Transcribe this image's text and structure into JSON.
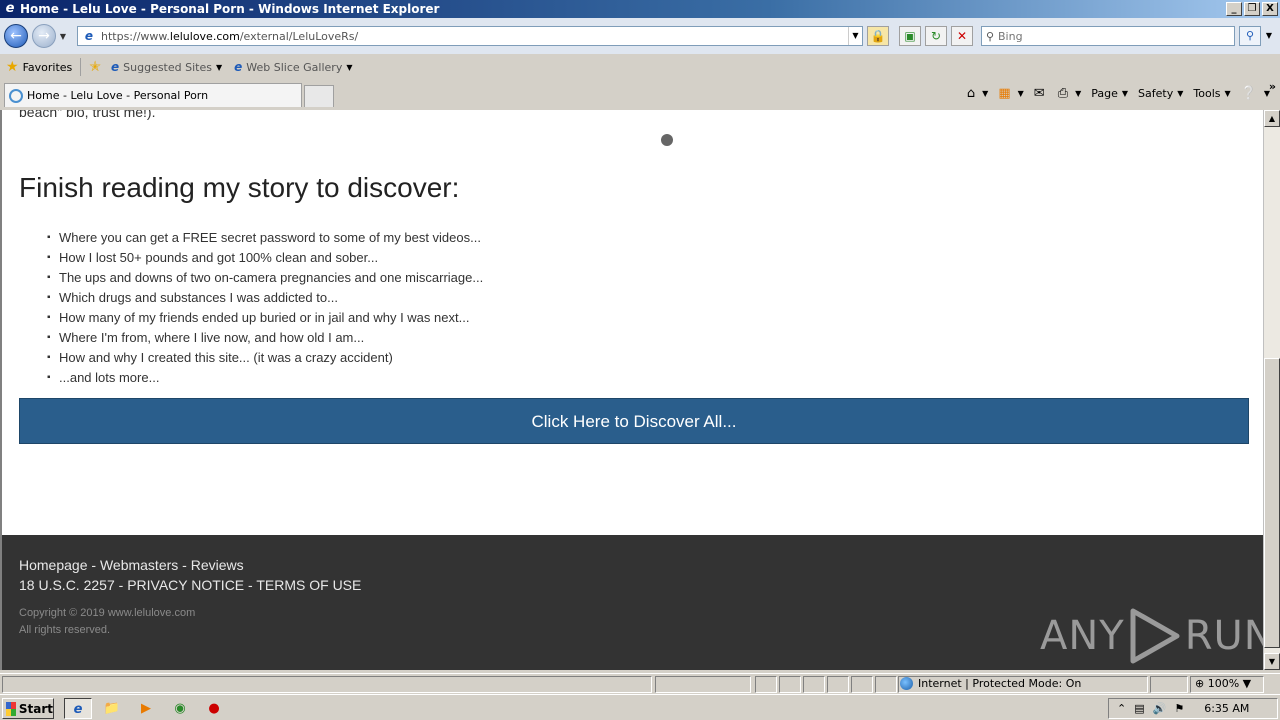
{
  "window": {
    "title": "Home - Lelu Love - Personal Porn - Windows Internet Explorer",
    "controls": {
      "minimize": "_",
      "restore": "❐",
      "close": "X"
    }
  },
  "address": {
    "url_prefix": "https://www.",
    "url_domain": "lelulove.com",
    "url_path": "/external/LeluLoveRs/"
  },
  "search": {
    "placeholder": "Bing"
  },
  "favorites": {
    "label": "Favorites",
    "items": [
      {
        "label": "Suggested Sites"
      },
      {
        "label": "Web Slice Gallery"
      }
    ]
  },
  "tab": {
    "title": "Home - Lelu Love - Personal Porn"
  },
  "commandbar": {
    "page": "Page",
    "safety": "Safety",
    "tools": "Tools"
  },
  "content": {
    "cutoff_text": "beach\" bio, trust me!).",
    "heading": "Finish reading my story to discover:",
    "points": [
      "Where you can get a FREE secret password to some of my best videos...",
      "How I lost 50+ pounds and got 100% clean and sober...",
      "The ups and downs of two on-camera pregnancies and one miscarriage...",
      "Which drugs and substances I was addicted to...",
      "How many of my friends ended up buried or in jail and why I was next...",
      "Where I'm from, where I live now, and how old I am...",
      "How and why I created this site... (it was a crazy accident)",
      "...and lots more..."
    ],
    "cta_label": "Click Here to Discover All..."
  },
  "footer": {
    "links_row1": [
      "Homepage",
      "Webmasters",
      "Reviews"
    ],
    "links_row2": [
      "18 U.S.C. 2257",
      "PRIVACY NOTICE",
      "TERMS OF USE"
    ],
    "separator": " - ",
    "copyright": "Copyright © 2019 www.lelulove.com",
    "rights": "All rights reserved."
  },
  "watermark": {
    "left": "ANY",
    "right": "RUN"
  },
  "statusbar": {
    "zone": "Internet | Protected Mode: On",
    "zoom": "100%"
  },
  "taskbar": {
    "start": "Start",
    "clock": "6:35 AM"
  }
}
